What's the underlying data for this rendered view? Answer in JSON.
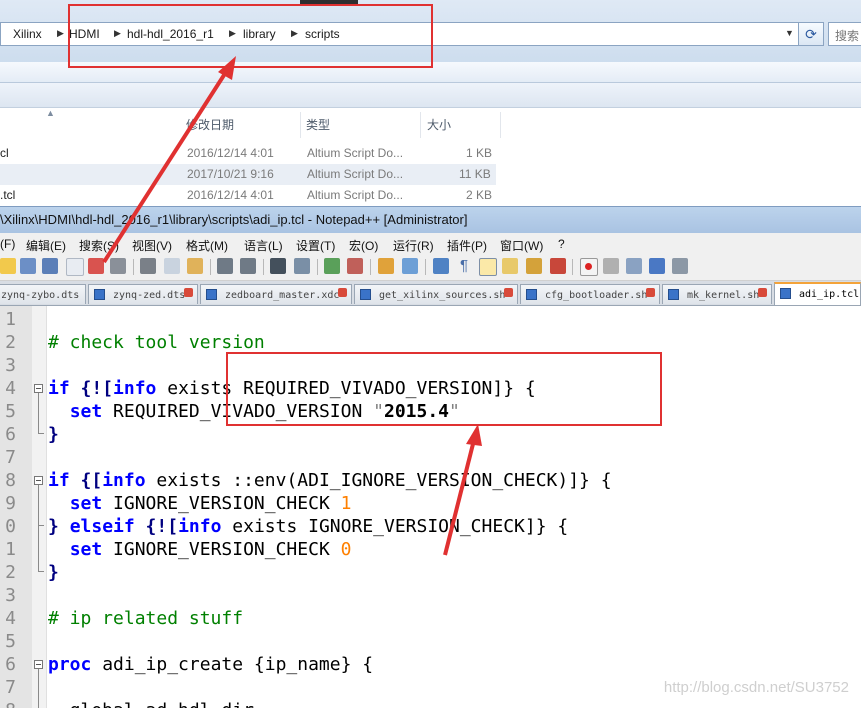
{
  "explorer": {
    "breadcrumbs": [
      "Xilinx",
      "HDMI",
      "hdl-hdl_2016_r1",
      "library",
      "scripts"
    ],
    "search_placeholder": "搜索 s",
    "columns": [
      "修改日期",
      "类型",
      "大小"
    ],
    "files": [
      {
        "name": "cl",
        "date": "2016/12/14 4:01",
        "type": "Altium Script Do...",
        "size": "1 KB"
      },
      {
        "name": "",
        "date": "2017/10/21 9:16",
        "type": "Altium Script Do...",
        "size": "11 KB"
      },
      {
        "name": ".tcl",
        "date": "2016/12/14 4:01",
        "type": "Altium Script Do...",
        "size": "2 KB"
      }
    ]
  },
  "npp": {
    "title": "\\Xilinx\\HDMI\\hdl-hdl_2016_r1\\library\\scripts\\adi_ip.tcl - Notepad++ [Administrator]",
    "menu": [
      "(F)",
      "编辑(E)",
      "搜索(S)",
      "视图(V)",
      "格式(M)",
      "语言(L)",
      "设置(T)",
      "宏(O)",
      "运行(R)",
      "插件(P)",
      "窗口(W)",
      "?"
    ],
    "tabs": [
      "zynq-zybo.dts",
      "zynq-zed.dts",
      "zedboard_master.xdc",
      "get_xilinx_sources.sh",
      "cfg_bootloader.sh",
      "mk_kernel.sh",
      "adi_ip.tcl"
    ],
    "active_tab": "adi_ip.tcl",
    "line_numbers": [
      "1",
      "2",
      "3",
      "4",
      "5",
      "6",
      "7",
      "8",
      "9",
      "0",
      "1",
      "2",
      "3",
      "4",
      "5",
      "6",
      "7",
      "8"
    ],
    "code": {
      "l2_comment": "# check tool version",
      "l4_kw": "if",
      "l4_rest_a": " {![",
      "l4_info": "info",
      "l4_rest_b": " exists REQUIRED_VIVADO_VERSION]} {",
      "l5_kw": "set",
      "l5_var": " REQUIRED_VIVADO_VERSION ",
      "l5_q1": "\"",
      "l5_val": "2015.4",
      "l5_q2": "\"",
      "l6": "}",
      "l8_kw": "if",
      "l8_rest_a": " {[",
      "l8_info": "info",
      "l8_rest_b": " exists ::env(ADI_IGNORE_VERSION_CHECK)]} {",
      "l9_kw": "set",
      "l9_var": " IGNORE_VERSION_CHECK ",
      "l9_num": "1",
      "l10_a": "} ",
      "l10_kw": "elseif",
      "l10_b": " {![",
      "l10_info": "info",
      "l10_c": " exists IGNORE_VERSION_CHECK]} {",
      "l11_kw": "set",
      "l11_var": " IGNORE_VERSION_CHECK ",
      "l11_num": "0",
      "l12": "}",
      "l14_comment": "# ip related stuff",
      "l16_kw": "proc",
      "l16_rest": " adi_ip_create {ip_name} {",
      "l18": "  global ad_hdl_dir"
    },
    "watermark": "http://blog.csdn.net/SU3752"
  },
  "colors": {
    "annotation": "#e03131",
    "keyword": "#0000ff",
    "comment": "#008000",
    "number": "#ff8000"
  }
}
